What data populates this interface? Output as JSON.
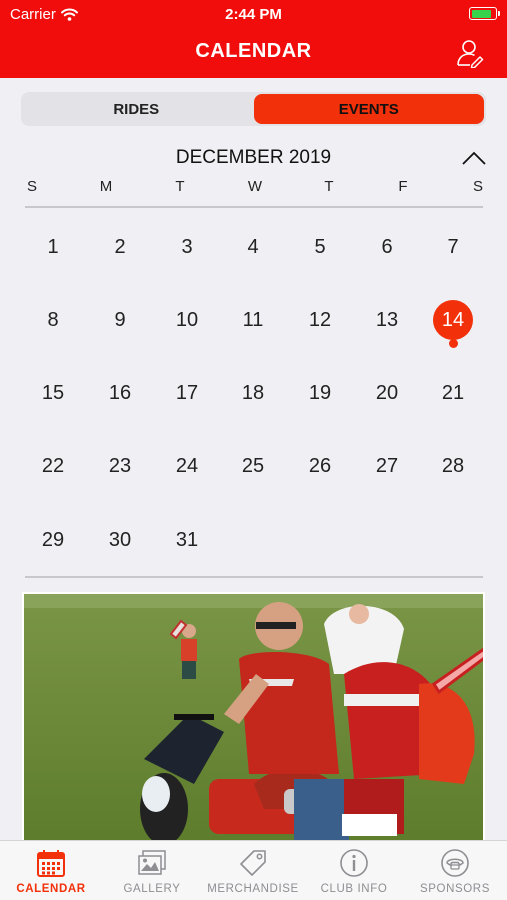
{
  "status_bar": {
    "carrier": "Carrier",
    "time": "2:44 PM"
  },
  "header": {
    "title": "CALENDAR",
    "profile_icon": "user-edit-icon"
  },
  "segments": [
    {
      "label": "RIDES",
      "active": false
    },
    {
      "label": "EVENTS",
      "active": true
    }
  ],
  "calendar": {
    "month_label": "DECEMBER 2019",
    "weekdays": [
      "S",
      "M",
      "T",
      "W",
      "T",
      "F",
      "S"
    ],
    "weeks": [
      [
        "1",
        "2",
        "3",
        "4",
        "5",
        "6",
        "7"
      ],
      [
        "8",
        "9",
        "10",
        "11",
        "12",
        "13",
        "14"
      ],
      [
        "15",
        "16",
        "17",
        "18",
        "19",
        "20",
        "21"
      ],
      [
        "22",
        "23",
        "24",
        "25",
        "26",
        "27",
        "28"
      ],
      [
        "29",
        "30",
        "31",
        "",
        "",
        "",
        ""
      ]
    ],
    "selected_day": "14",
    "event_days": [
      "14"
    ]
  },
  "tabbar": {
    "tabs": [
      {
        "label": "CALENDAR",
        "icon": "calendar-icon",
        "active": true
      },
      {
        "label": "GALLERY",
        "icon": "gallery-icon",
        "active": false
      },
      {
        "label": "MERCHANDISE",
        "icon": "tag-icon",
        "active": false
      },
      {
        "label": "CLUB INFO",
        "icon": "info-icon",
        "active": false
      },
      {
        "label": "SPONSORS",
        "icon": "phone-icon",
        "active": false
      }
    ]
  },
  "colors": {
    "brand_red": "#f20d0d",
    "accent": "#f2300a",
    "inactive_tab": "#8e8e93"
  }
}
